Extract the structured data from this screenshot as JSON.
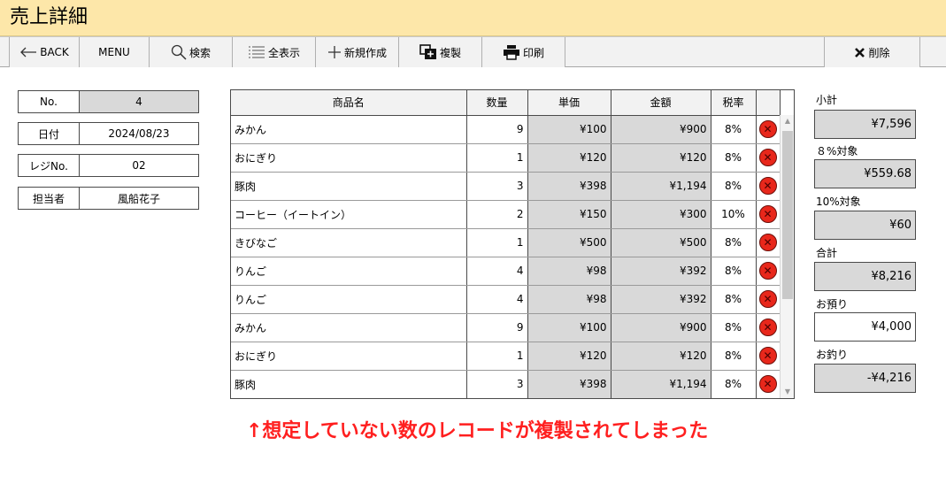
{
  "window": {
    "title": "売上詳細"
  },
  "toolbar": {
    "back": "BACK",
    "menu": "MENU",
    "search": "検索",
    "show_all": "全表示",
    "new": "新規作成",
    "duplicate": "複製",
    "print": "印刷",
    "delete": "削除"
  },
  "info": {
    "no_label": "No.",
    "no_value": "4",
    "date_label": "日付",
    "date_value": "2024/08/23",
    "register_label": "レジNo.",
    "register_value": "02",
    "staff_label": "担当者",
    "staff_value": "風船花子"
  },
  "table": {
    "headers": {
      "name": "商品名",
      "qty": "数量",
      "price": "単価",
      "amount": "金額",
      "tax": "税率"
    },
    "rows": [
      {
        "name": "みかん",
        "qty": "9",
        "price": "¥100",
        "amount": "¥900",
        "tax": "8%"
      },
      {
        "name": "おにぎり",
        "qty": "1",
        "price": "¥120",
        "amount": "¥120",
        "tax": "8%"
      },
      {
        "name": "豚肉",
        "qty": "3",
        "price": "¥398",
        "amount": "¥1,194",
        "tax": "8%"
      },
      {
        "name": "コーヒー（イートイン）",
        "qty": "2",
        "price": "¥150",
        "amount": "¥300",
        "tax": "10%"
      },
      {
        "name": "きびなご",
        "qty": "1",
        "price": "¥500",
        "amount": "¥500",
        "tax": "8%"
      },
      {
        "name": "りんご",
        "qty": "4",
        "price": "¥98",
        "amount": "¥392",
        "tax": "8%"
      },
      {
        "name": "りんご",
        "qty": "4",
        "price": "¥98",
        "amount": "¥392",
        "tax": "8%"
      },
      {
        "name": "みかん",
        "qty": "9",
        "price": "¥100",
        "amount": "¥900",
        "tax": "8%"
      },
      {
        "name": "おにぎり",
        "qty": "1",
        "price": "¥120",
        "amount": "¥120",
        "tax": "8%"
      },
      {
        "name": "豚肉",
        "qty": "3",
        "price": "¥398",
        "amount": "¥1,194",
        "tax": "8%"
      }
    ]
  },
  "summary": {
    "subtotal_label": "小計",
    "subtotal_value": "¥7,596",
    "tax8_label": "８%対象",
    "tax8_value": "¥559.68",
    "tax10_label": "10%対象",
    "tax10_value": "¥60",
    "total_label": "合計",
    "total_value": "¥8,216",
    "received_label": "お預り",
    "received_value": "¥4,000",
    "change_label": "お釣り",
    "change_value": "-¥4,216"
  },
  "annotation": "↑想定していない数のレコードが複製されてしまった",
  "colors": {
    "title_bg": "#fde7a9",
    "delete_icon": "#e8271b",
    "annotation": "#ff1f1f",
    "field_gray": "#d9d9d9"
  }
}
